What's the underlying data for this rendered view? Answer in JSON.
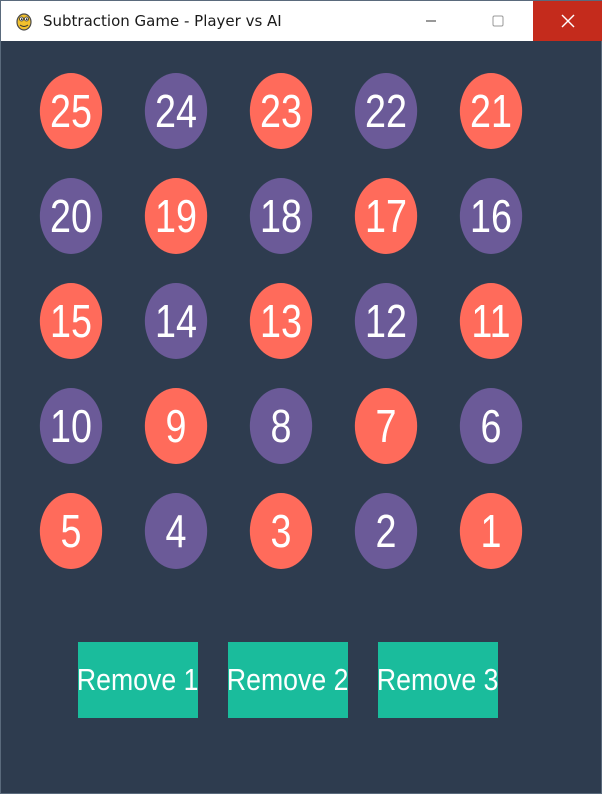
{
  "window": {
    "title": "Subtraction Game - Player vs AI",
    "close_bg": "#c42b1c"
  },
  "game": {
    "tiles": [
      {
        "label": "25",
        "color": "coral"
      },
      {
        "label": "24",
        "color": "purple"
      },
      {
        "label": "23",
        "color": "coral"
      },
      {
        "label": "22",
        "color": "purple"
      },
      {
        "label": "21",
        "color": "coral"
      },
      {
        "label": "20",
        "color": "purple"
      },
      {
        "label": "19",
        "color": "coral"
      },
      {
        "label": "18",
        "color": "purple"
      },
      {
        "label": "17",
        "color": "coral"
      },
      {
        "label": "16",
        "color": "purple"
      },
      {
        "label": "15",
        "color": "coral"
      },
      {
        "label": "14",
        "color": "purple"
      },
      {
        "label": "13",
        "color": "coral"
      },
      {
        "label": "12",
        "color": "purple"
      },
      {
        "label": "11",
        "color": "coral"
      },
      {
        "label": "10",
        "color": "purple"
      },
      {
        "label": "9",
        "color": "coral"
      },
      {
        "label": "8",
        "color": "purple"
      },
      {
        "label": "7",
        "color": "coral"
      },
      {
        "label": "6",
        "color": "purple"
      },
      {
        "label": "5",
        "color": "coral"
      },
      {
        "label": "4",
        "color": "purple"
      },
      {
        "label": "3",
        "color": "coral"
      },
      {
        "label": "2",
        "color": "purple"
      },
      {
        "label": "1",
        "color": "coral"
      }
    ],
    "buttons": [
      {
        "label": "Remove 1"
      },
      {
        "label": "Remove 2"
      },
      {
        "label": "Remove 3"
      }
    ],
    "colors": {
      "background": "#2e3c4f",
      "coral": "#ff6b5b",
      "purple": "#6b5a98",
      "button": "#1abc9c"
    }
  }
}
